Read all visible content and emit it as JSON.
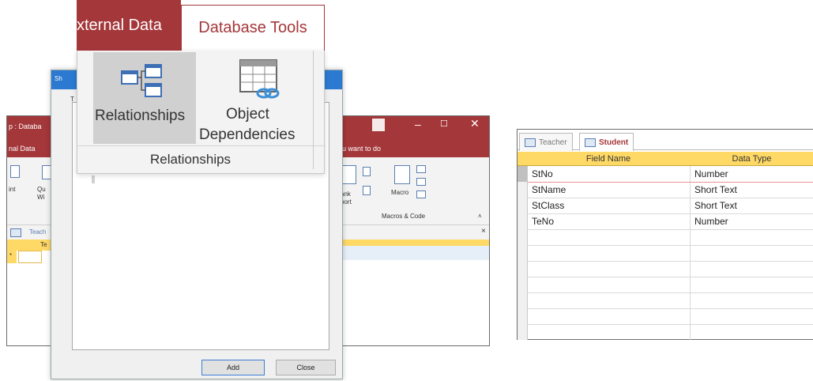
{
  "ribbon": {
    "tab_external": "xternal Data",
    "tab_database_tools": "Database Tools",
    "relationships_label": "Relationships",
    "object_label": "Object",
    "dependencies_label": "Dependencies",
    "group_label": "Relationships",
    "accent": "#a4373a"
  },
  "background_window": {
    "title_fragment": "p : Databa",
    "tab_fragment": "nal Data",
    "tell_me_fragment": "u want to do",
    "macro_label": "Macro",
    "group_label": "Macros & Code",
    "object_tab_fragment": "Teach",
    "grid_header_fragment": "Te"
  },
  "show_table_dialog": {
    "title_fragment": "Sh",
    "tab_fragment": "T",
    "add_label": "Add",
    "close_label": "Close"
  },
  "table_design": {
    "tabs": [
      "Teacher",
      "Student"
    ],
    "headers": {
      "field_name": "Field Name",
      "data_type": "Data Type"
    },
    "rows": [
      {
        "field": "StNo",
        "type": "Number"
      },
      {
        "field": "StName",
        "type": "Short Text"
      },
      {
        "field": "StClass",
        "type": "Short Text"
      },
      {
        "field": "TeNo",
        "type": "Number"
      }
    ],
    "header_color": "#ffd966"
  }
}
